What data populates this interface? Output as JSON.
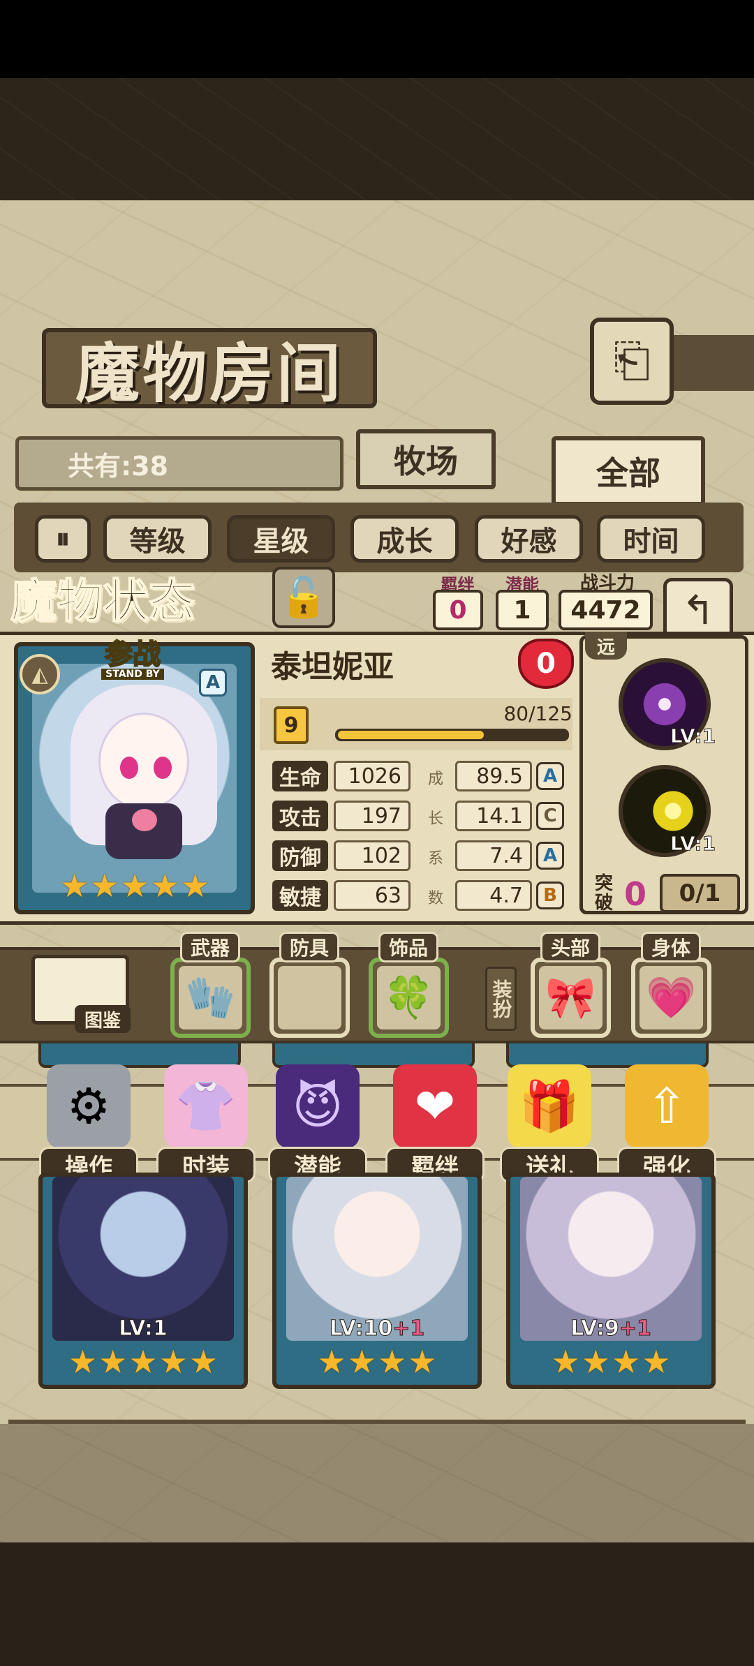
{
  "room": {
    "title": "魔物房间",
    "total_label": "共有:38",
    "tabs": [
      {
        "label": "牧场"
      },
      {
        "label": "全部"
      }
    ]
  },
  "filters": [
    {
      "label": "等级"
    },
    {
      "label": "星级"
    },
    {
      "label": "成长"
    },
    {
      "label": "好感"
    },
    {
      "label": "时间"
    }
  ],
  "status": {
    "title": "魔物状态",
    "bond_label": "羁绊",
    "bond_value": "0",
    "potential_label": "潜能",
    "potential_value": "1",
    "power_label": "战斗力",
    "power_value": "4472"
  },
  "monster": {
    "name": "泰坦妮亚",
    "affection": "0",
    "standby": "参战",
    "standby_en": "STAND BY",
    "rank": "A",
    "stars": 5,
    "level": "9",
    "exp_text": "80/125",
    "exp_fraction": 0.64,
    "range": "远",
    "stats": [
      {
        "label": "生命",
        "value": "1026",
        "growth": "89.5",
        "grade": "A"
      },
      {
        "label": "攻击",
        "value": "197",
        "growth": "14.1",
        "grade": "C"
      },
      {
        "label": "防御",
        "value": "102",
        "growth": "7.4",
        "grade": "A"
      },
      {
        "label": "敏捷",
        "value": "63",
        "growth": "4.7",
        "grade": "B"
      }
    ],
    "growth_chars": [
      "成",
      "长",
      "系",
      "数"
    ],
    "skills": [
      {
        "level": "LV:1"
      },
      {
        "level": "LV:1"
      }
    ],
    "breakthrough_label": "突破",
    "breakthrough_value": "0",
    "breakthrough_progress": "0/1"
  },
  "equipment": {
    "atlas_label": "图鉴",
    "weapon_label": "武器",
    "armor_label": "防具",
    "accessory_label": "饰品",
    "dress_label": "装扮",
    "head_label": "头部",
    "body_label": "身体"
  },
  "actions": [
    {
      "label": "操作"
    },
    {
      "label": "时装"
    },
    {
      "label": "潜能"
    },
    {
      "label": "羁绊"
    },
    {
      "label": "送礼"
    },
    {
      "label": "强化"
    }
  ],
  "cards": [
    {
      "level": "LV:1",
      "plus": "",
      "stars": 5
    },
    {
      "level": "LV:10",
      "plus": "+1",
      "stars": 4
    },
    {
      "level": "LV:9",
      "plus": "+1",
      "stars": 4
    }
  ],
  "colors": {
    "accent_gold": "#f6b72b",
    "accent_pink": "#c23a8a",
    "frame": "#3f3222"
  }
}
